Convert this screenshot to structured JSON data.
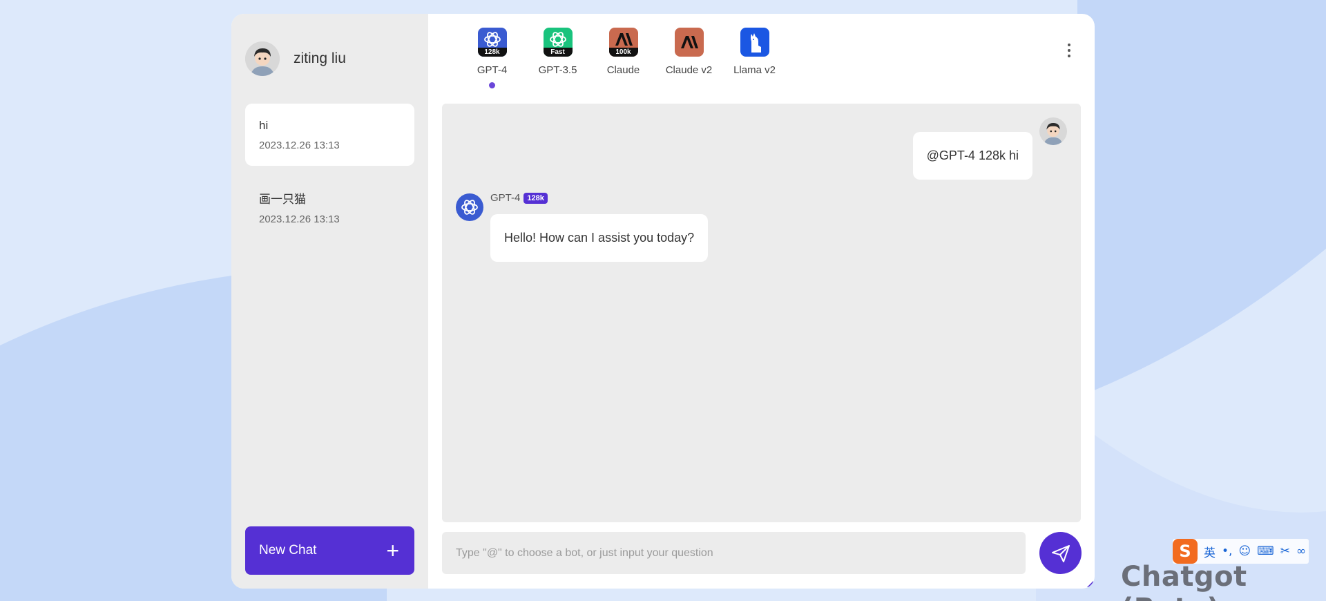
{
  "colors": {
    "accent": "#5530d4",
    "background": "#dce8fb",
    "sidebar": "#ececec"
  },
  "user": {
    "name": "ziting liu"
  },
  "sidebar": {
    "chats": [
      {
        "title": "hi",
        "date": "2023.12.26 13:13",
        "active": true
      },
      {
        "title": "画一只猫",
        "date": "2023.12.26 13:13",
        "active": false
      }
    ],
    "new_chat_label": "New Chat",
    "new_chat_icon": "plus-icon"
  },
  "bots": [
    {
      "label": "GPT-4",
      "badge": "128k",
      "icon": "openai-logo-icon",
      "color": "#3a5bd1",
      "selected": true
    },
    {
      "label": "GPT-3.5",
      "badge": "Fast",
      "icon": "openai-logo-icon",
      "color": "#19c37d",
      "selected": false
    },
    {
      "label": "Claude",
      "badge": "100k",
      "icon": "anthropic-logo-icon",
      "color": "#c96a4f",
      "selected": false
    },
    {
      "label": "Claude v2",
      "badge": "",
      "icon": "anthropic-logo-icon",
      "color": "#c96a4f",
      "selected": false
    },
    {
      "label": "Llama v2",
      "badge": "",
      "icon": "llama-icon",
      "color": "#1b57e3",
      "selected": false
    }
  ],
  "conversation": {
    "user_message": "@GPT-4 128k hi",
    "bot_name": "GPT-4",
    "bot_tag": "128k",
    "bot_message": "Hello! How can I assist you today?"
  },
  "input": {
    "placeholder": "Type \"@\" to choose a bot, or just input your question",
    "value": ""
  },
  "ime": {
    "logo": "S",
    "items": [
      "英",
      "•,",
      "☺",
      "⌨",
      "✂",
      "∞"
    ]
  },
  "watermark": "Chatgot (Beta)"
}
